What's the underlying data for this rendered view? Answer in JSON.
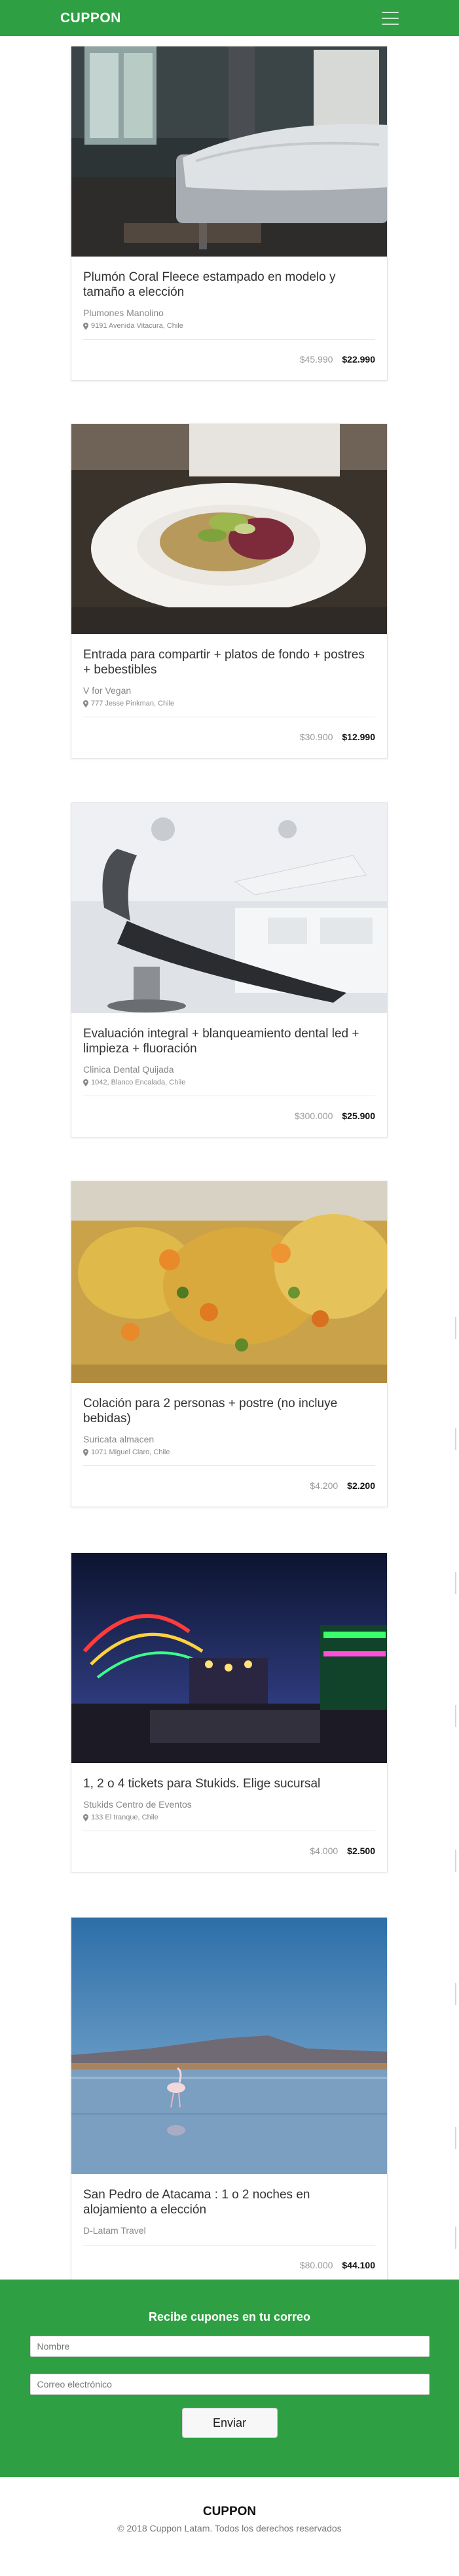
{
  "header": {
    "logo": "CUPPON",
    "menu_icon": "hamburger-menu-icon"
  },
  "deals": [
    {
      "title": "Plumón Coral Fleece estampado en modelo y tamaño a elección",
      "merchant": "Plumones Manolino",
      "address": "9191 Avenida Vitacura, Chile",
      "old_price": "$45.990",
      "new_price": "$22.990",
      "image": "bedroom-photo"
    },
    {
      "title": "Entrada para compartir + platos de fondo + postres + bebestibles",
      "merchant": "V for Vegan",
      "address": "777 Jesse Pinkman, Chile",
      "old_price": "$30.900",
      "new_price": "$12.990",
      "image": "salad-plate-photo"
    },
    {
      "title": "Evaluación integral + blanqueamiento dental led + limpieza + fluoración",
      "merchant": "Clinica Dental Quijada",
      "address": "1042, Blanco Encalada, Chile",
      "old_price": "$300.000",
      "new_price": "$25.900",
      "image": "dental-chair-photo"
    },
    {
      "title": "Colación para 2 personas + postre (no incluye bebidas)",
      "merchant": "Suricata almacen",
      "address": "1071 Miguel Claro, Chile",
      "old_price": "$4.200",
      "new_price": "$2.200",
      "image": "food-closeup-photo"
    },
    {
      "title": "1, 2 o 4 tickets para Stukids. Elige sucursal",
      "merchant": "Stukids Centro de Eventos",
      "address": "133 El tranque, Chile",
      "old_price": "$4.000",
      "new_price": "$2.500",
      "image": "fair-rides-photo"
    },
    {
      "title": "San Pedro de Atacama : 1 o 2 noches en alojamiento a elección",
      "merchant": "D-Latam Travel",
      "address": "",
      "old_price": "$80.000",
      "new_price": "$44.100",
      "image": "flamingo-lake-photo"
    }
  ],
  "newsletter": {
    "title": "Recibe cupones en tu correo",
    "name_placeholder": "Nombre",
    "email_placeholder": "Correo electrónico",
    "submit_label": "Enviar"
  },
  "footer": {
    "logo": "CUPPON",
    "copyright": "© 2018 Cuppon Latam. Todos los derechos reservados"
  },
  "colors": {
    "brand_green": "#2ea043",
    "price_old": "#999999",
    "price_new": "#111111"
  }
}
